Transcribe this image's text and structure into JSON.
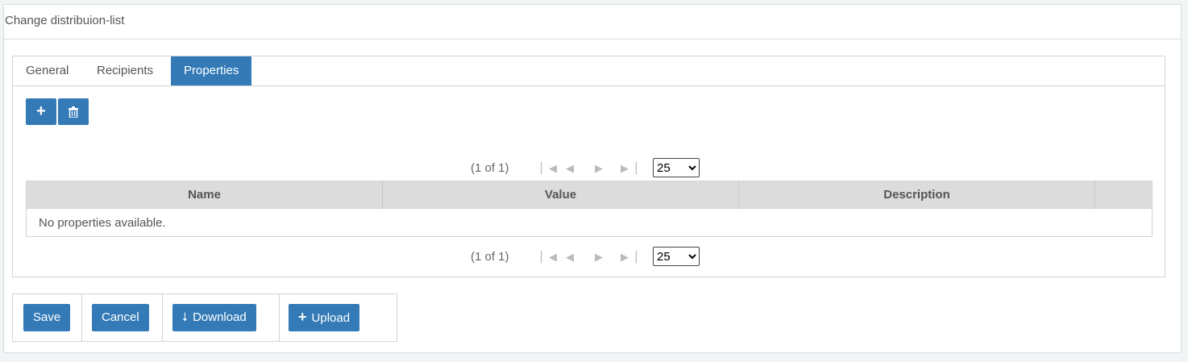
{
  "panel": {
    "title": "Change distribuion-list"
  },
  "tabs": [
    {
      "label": "General",
      "active": false
    },
    {
      "label": "Recipients",
      "active": false
    },
    {
      "label": "Properties",
      "active": true
    }
  ],
  "toolbar": {
    "add_icon": "plus-icon",
    "delete_icon": "trash-icon"
  },
  "paginator": {
    "page_report": "(1 of 1)",
    "rows_per_page": "25",
    "rows_options": [
      "25"
    ]
  },
  "table": {
    "columns": [
      "Name",
      "Value",
      "Description",
      ""
    ],
    "empty_message": "No properties available."
  },
  "footer": {
    "save_label": "Save",
    "cancel_label": "Cancel",
    "download_label": "Download",
    "upload_label": "Upload"
  },
  "colors": {
    "accent": "#337ab7",
    "header_bg": "#dcdcdc"
  }
}
